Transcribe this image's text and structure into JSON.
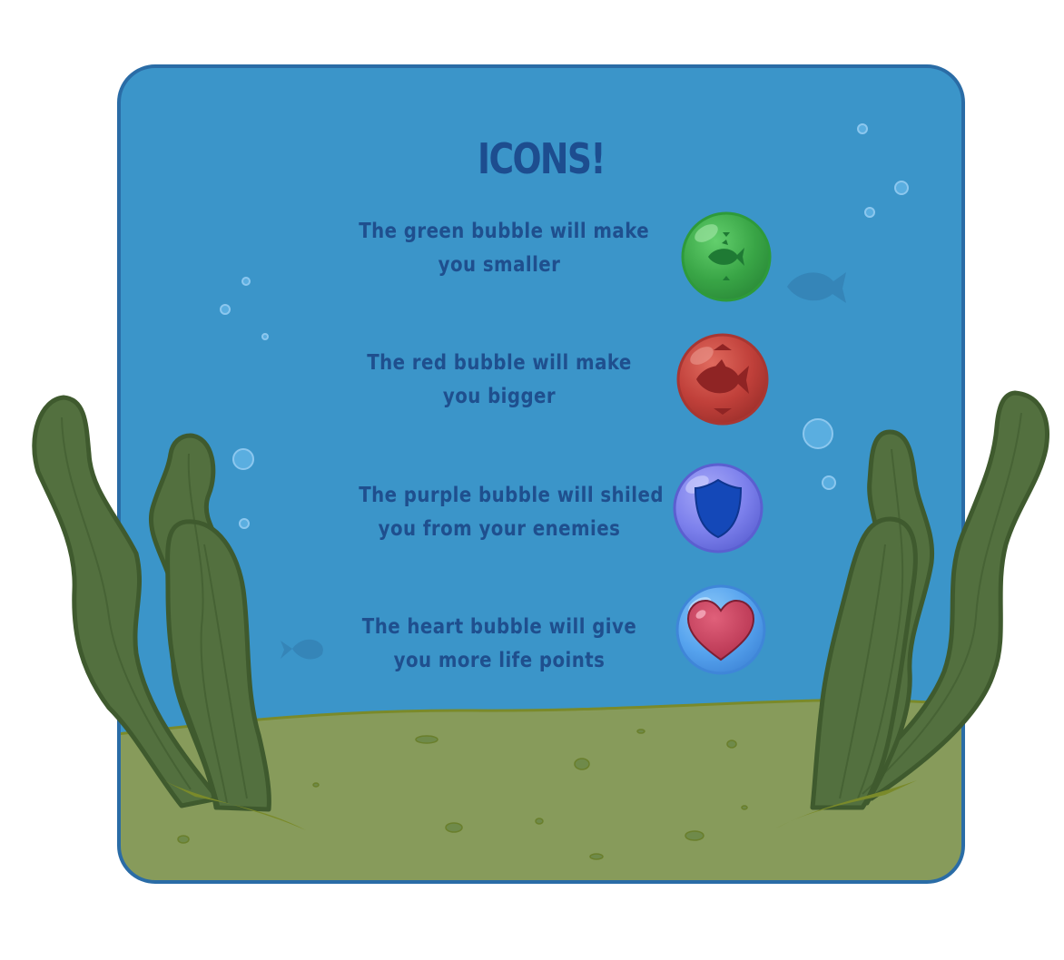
{
  "panel": {
    "title": "ICONS!"
  },
  "rows": [
    {
      "line1": "The green bubble will make",
      "line2": "you smaller",
      "icon": "fish-shrink-icon",
      "color": "#3aa84a"
    },
    {
      "line1": "The red bubble will make",
      "line2": "you bigger",
      "icon": "fish-grow-icon",
      "color": "#c3403a"
    },
    {
      "line1": "The purple bubble will shiled",
      "line2": "you from your enemies",
      "icon": "shield-icon",
      "color": "#7f82ee"
    },
    {
      "line1": "The heart bubble will give",
      "line2": "you more life points",
      "icon": "heart-icon",
      "color": "#4f9fe8"
    }
  ],
  "colors": {
    "water": "#3b95c9",
    "sand": "#869a5a",
    "seaweed": "#53703f",
    "text": "#1f4f8e",
    "frame": "#2a6ca6"
  }
}
